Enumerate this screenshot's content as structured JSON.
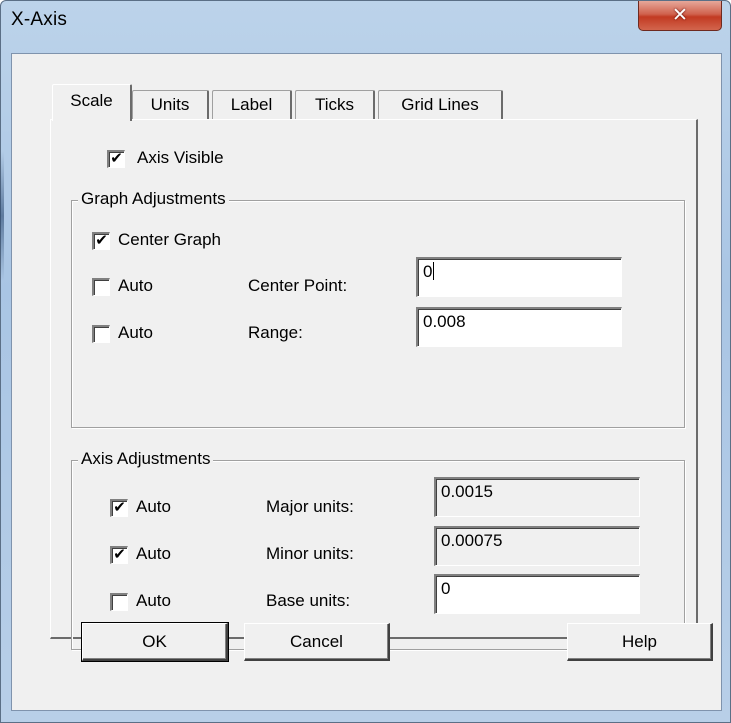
{
  "window": {
    "title": "X-Axis",
    "close_icon": "close-icon"
  },
  "tabs": [
    {
      "label": "Scale",
      "active": true
    },
    {
      "label": "Units",
      "active": false
    },
    {
      "label": "Label",
      "active": false
    },
    {
      "label": "Ticks",
      "active": false
    },
    {
      "label": "Grid Lines",
      "active": false
    }
  ],
  "axis_visible": {
    "label": "Axis Visible",
    "checked": true
  },
  "graph_adjustments": {
    "title": "Graph Adjustments",
    "center_graph": {
      "label": "Center Graph",
      "checked": true
    },
    "center_point": {
      "auto_label": "Auto",
      "auto_checked": false,
      "label": "Center Point:",
      "value": "0"
    },
    "range": {
      "auto_label": "Auto",
      "auto_checked": false,
      "label": "Range:",
      "value": "0.008"
    }
  },
  "axis_adjustments": {
    "title": "Axis Adjustments",
    "major_units": {
      "auto_label": "Auto",
      "auto_checked": true,
      "label": "Major units:",
      "value": "0.0015"
    },
    "minor_units": {
      "auto_label": "Auto",
      "auto_checked": true,
      "label": "Minor units:",
      "value": "0.00075"
    },
    "base_units": {
      "auto_label": "Auto",
      "auto_checked": false,
      "label": "Base units:",
      "value": "0"
    }
  },
  "buttons": {
    "ok": "OK",
    "cancel": "Cancel",
    "help": "Help"
  },
  "check_mark": "✔"
}
